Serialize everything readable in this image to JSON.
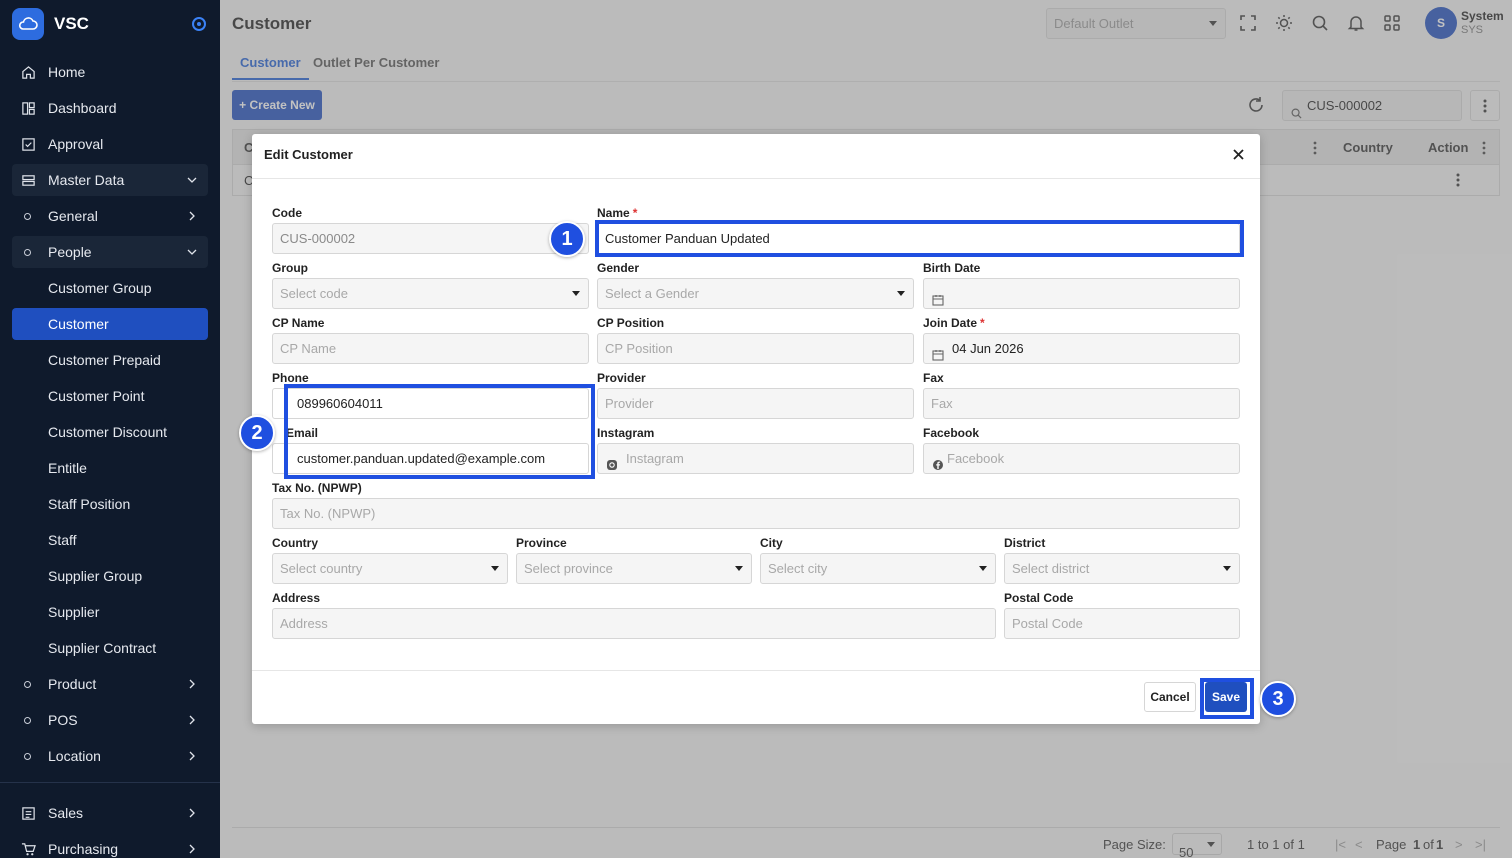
{
  "app": {
    "name": "VSC"
  },
  "sidebar": {
    "items": [
      {
        "label": "Home",
        "icon": "home-icon"
      },
      {
        "label": "Dashboard",
        "icon": "dashboard-icon"
      },
      {
        "label": "Approval",
        "icon": "approval-icon"
      },
      {
        "label": "Master Data",
        "icon": "database-icon"
      },
      {
        "label": "General"
      },
      {
        "label": "People"
      },
      {
        "label": "Product"
      },
      {
        "label": "POS"
      },
      {
        "label": "Location"
      },
      {
        "label": "Sales",
        "icon": "sales-icon"
      },
      {
        "label": "Purchasing",
        "icon": "cart-icon"
      }
    ],
    "people_sub": [
      "Customer Group",
      "Customer",
      "Customer Prepaid",
      "Customer Point",
      "Customer Discount",
      "Entitle",
      "Staff Position",
      "Staff",
      "Supplier Group",
      "Supplier",
      "Supplier Contract"
    ]
  },
  "header": {
    "title": "Customer",
    "outlet_placeholder": "Default Outlet",
    "user_initial": "S",
    "user_name": "System",
    "user_role": "SYS"
  },
  "tabs": [
    "Customer",
    "Outlet Per Customer"
  ],
  "toolbar": {
    "create_label": "+ Create New",
    "search_value": "CUS-000002"
  },
  "grid": {
    "col_first": "C",
    "col_country": "Country",
    "col_action": "Action",
    "row_first": "C"
  },
  "footer": {
    "page_size_label": "Page Size:",
    "page_size": "50",
    "range": "1 to 1 of 1",
    "page_label": "Page",
    "page_current": "1",
    "page_of": "of",
    "page_total": "1"
  },
  "modal": {
    "title": "Edit Customer",
    "fields": {
      "code": {
        "label": "Code",
        "value": "CUS-000002"
      },
      "name": {
        "label": "Name",
        "value": "Customer Panduan Updated"
      },
      "group": {
        "label": "Group",
        "placeholder": "Select code"
      },
      "gender": {
        "label": "Gender",
        "placeholder": "Select a Gender"
      },
      "birth_date": {
        "label": "Birth Date",
        "value": ""
      },
      "cp_name": {
        "label": "CP Name",
        "placeholder": "CP Name"
      },
      "cp_position": {
        "label": "CP Position",
        "placeholder": "CP Position"
      },
      "join_date": {
        "label": "Join Date",
        "value": "04 Jun 2026"
      },
      "phone": {
        "label": "Phone",
        "value": "089960604011"
      },
      "provider": {
        "label": "Provider",
        "placeholder": "Provider"
      },
      "fax": {
        "label": "Fax",
        "placeholder": "Fax"
      },
      "email": {
        "label": "Email",
        "value": "customer.panduan.updated@example.com"
      },
      "instagram": {
        "label": "Instagram",
        "placeholder": "Instagram"
      },
      "facebook": {
        "label": "Facebook",
        "placeholder": "Facebook"
      },
      "tax_no": {
        "label": "Tax No. (NPWP)",
        "placeholder": "Tax No. (NPWP)"
      },
      "country": {
        "label": "Country",
        "placeholder": "Select country"
      },
      "province": {
        "label": "Province",
        "placeholder": "Select province"
      },
      "city": {
        "label": "City",
        "placeholder": "Select city"
      },
      "district": {
        "label": "District",
        "placeholder": "Select district"
      },
      "address": {
        "label": "Address",
        "placeholder": "Address"
      },
      "postal_code": {
        "label": "Postal Code",
        "placeholder": "Postal Code"
      }
    },
    "required_mark": "*",
    "cancel_label": "Cancel",
    "save_label": "Save"
  },
  "annotations": [
    "1",
    "2",
    "3"
  ],
  "colors": {
    "primary": "#1f4fbf",
    "sidebar_bg": "#0f1a2c",
    "highlight": "#1f4fe0",
    "required": "#dd3333"
  }
}
